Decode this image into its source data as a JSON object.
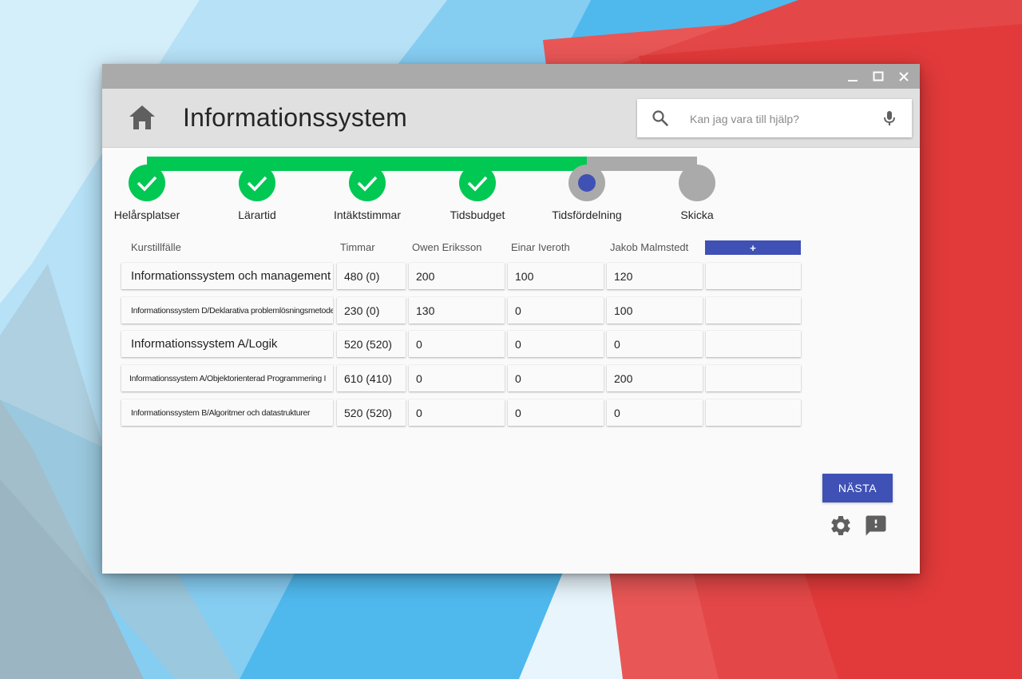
{
  "window": {
    "title_controls": [
      "minimize-icon",
      "maximize-icon",
      "close-icon"
    ]
  },
  "header": {
    "title": "Informationssystem",
    "search_placeholder": "Kan jag vara till hjälp?"
  },
  "stepper": {
    "steps": [
      {
        "label": "Helårsplatser",
        "state": "done"
      },
      {
        "label": "Lärartid",
        "state": "done"
      },
      {
        "label": "Intäktstimmar",
        "state": "done"
      },
      {
        "label": "Tidsbudget",
        "state": "done"
      },
      {
        "label": "Tidsfördelning",
        "state": "current"
      },
      {
        "label": "Skicka",
        "state": "pending"
      }
    ]
  },
  "table": {
    "headers": [
      "Kurstillfälle",
      "Timmar",
      "Owen Eriksson",
      "Einar Iveroth",
      "Jakob Malmstedt"
    ],
    "add_column_label": "+",
    "rows": [
      {
        "course": "Informationssystem och management",
        "hours": "480 (0)",
        "owen": "200",
        "einar": "100",
        "jakob": "120"
      },
      {
        "course": "Informationssystem D/Deklarativa problemlösningsmetoder",
        "hours": "230 (0)",
        "owen": "130",
        "einar": "0",
        "jakob": "100"
      },
      {
        "course": "Informationssystem A/Logik",
        "hours": "520 (520)",
        "owen": "0",
        "einar": "0",
        "jakob": "0"
      },
      {
        "course": "Informationssystem A/Objektorienterad Programmering I",
        "hours": "610 (410)",
        "owen": "0",
        "einar": "0",
        "jakob": "200"
      },
      {
        "course": "Informationssystem B/Algoritmer och datastrukturer",
        "hours": "520 (520)",
        "owen": "0",
        "einar": "0",
        "jakob": "0"
      }
    ]
  },
  "actions": {
    "next_label": "NÄSTA"
  },
  "colors": {
    "primary": "#3f51b5",
    "success": "#00c853",
    "inactive": "#aaaaaa"
  }
}
